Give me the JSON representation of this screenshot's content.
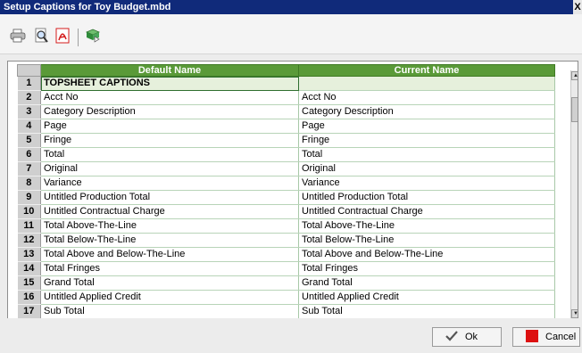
{
  "window": {
    "title": "Setup Captions for Toy Budget.mbd",
    "close_glyph": "X"
  },
  "toolbar": {
    "icons": [
      "print-icon",
      "print-preview-icon",
      "pdf-icon",
      "export-icon"
    ],
    "colors": {
      "pdf": "#d41c1c",
      "export": "#2e8b3a"
    }
  },
  "grid": {
    "columns": [
      "Default Name",
      "Current Name"
    ],
    "header_color": "#5a9a38",
    "rows": [
      {
        "n": "1",
        "default": "TOPSHEET CAPTIONS",
        "current": ""
      },
      {
        "n": "2",
        "default": "Acct No",
        "current": "Acct No"
      },
      {
        "n": "3",
        "default": "Category Description",
        "current": "Category Description"
      },
      {
        "n": "4",
        "default": "Page",
        "current": "Page"
      },
      {
        "n": "5",
        "default": "Fringe",
        "current": "Fringe"
      },
      {
        "n": "6",
        "default": "Total",
        "current": "Total"
      },
      {
        "n": "7",
        "default": "Original",
        "current": "Original"
      },
      {
        "n": "8",
        "default": "Variance",
        "current": "Variance"
      },
      {
        "n": "9",
        "default": "Untitled Production Total",
        "current": "Untitled Production Total"
      },
      {
        "n": "10",
        "default": "Untitled Contractual Charge",
        "current": "Untitled Contractual Charge"
      },
      {
        "n": "11",
        "default": "Total Above-The-Line",
        "current": "Total Above-The-Line"
      },
      {
        "n": "12",
        "default": "Total Below-The-Line",
        "current": "Total Below-The-Line"
      },
      {
        "n": "13",
        "default": "Total Above and Below-The-Line",
        "current": "Total Above and Below-The-Line"
      },
      {
        "n": "14",
        "default": "Total Fringes",
        "current": "Total Fringes"
      },
      {
        "n": "15",
        "default": "Grand Total",
        "current": "Grand Total"
      },
      {
        "n": "16",
        "default": "Untitled Applied Credit",
        "current": "Untitled Applied Credit"
      },
      {
        "n": "17",
        "default": "Sub Total",
        "current": "Sub Total"
      }
    ]
  },
  "buttons": {
    "ok": {
      "label": "Ok",
      "icon": "ok-check-icon"
    },
    "cancel": {
      "label": "Cancel",
      "icon": "cancel-square-icon",
      "color": "#dd1111"
    }
  }
}
